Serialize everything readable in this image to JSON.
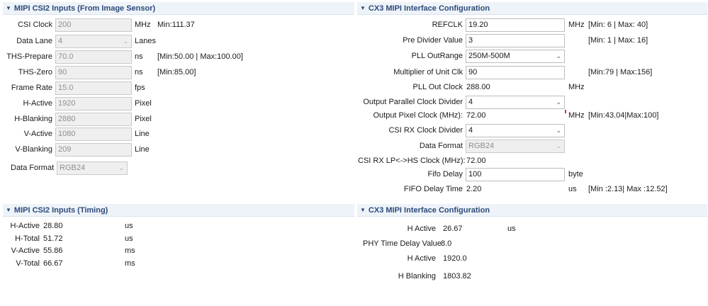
{
  "left_inputs": {
    "title": "MIPI CSI2 Inputs (From Image Sensor)",
    "rows": [
      {
        "label": "CSI Clock",
        "value": "200",
        "unit": "MHz",
        "hint": "Min:111.37"
      },
      {
        "label": "Data Lane",
        "value": "4",
        "unit": "Lanes",
        "hint": ""
      },
      {
        "label": "THS-Prepare",
        "value": "70.0",
        "unit": "ns",
        "hint": "[Min:50.00 | Max:100.00]"
      },
      {
        "label": "THS-Zero",
        "value": "90",
        "unit": "ns",
        "hint": "[Min:85.00]"
      },
      {
        "label": "Frame Rate",
        "value": "15.0",
        "unit": "fps",
        "hint": ""
      },
      {
        "label": "H-Active",
        "value": "1920",
        "unit": "Pixel",
        "hint": ""
      },
      {
        "label": "H-Blanking",
        "value": "2880",
        "unit": "Pixel",
        "hint": ""
      },
      {
        "label": "V-Active",
        "value": "1080",
        "unit": "Line",
        "hint": ""
      },
      {
        "label": "V-Blanking",
        "value": "209",
        "unit": "Line",
        "hint": ""
      },
      {
        "label": "Data Format",
        "value": "RGB24",
        "unit": "",
        "hint": ""
      }
    ]
  },
  "right_config": {
    "title": "CX3 MIPI Interface Configuration",
    "rows": [
      {
        "label": "REFCLK",
        "value": "19.20",
        "unit": "MHz",
        "hint": "[Min: 6 | Max: 40]"
      },
      {
        "label": "Pre Divider Value",
        "value": "3",
        "unit": "",
        "hint": "[Min: 1 | Max: 16]"
      },
      {
        "label": "PLL OutRange",
        "value": "250M-500M",
        "unit": "",
        "hint": ""
      },
      {
        "label": "Multiplier of Unit Clk",
        "value": "90",
        "unit": "",
        "hint": "[Min:79 | Max:156]"
      },
      {
        "label": "PLL Out Clock",
        "value": "288.00",
        "unit": "MHz",
        "hint": ""
      },
      {
        "label": "Output Parallel Clock Divider",
        "value": "4",
        "unit": "",
        "hint": ""
      },
      {
        "label": "Output Pixel Clock (MHz):",
        "value": "72.00",
        "unit": "MHz",
        "hint": "[Min:43.04|Max:100]"
      },
      {
        "label": "CSI RX Clock Divider",
        "value": "4",
        "unit": "",
        "hint": ""
      },
      {
        "label": "Data Format",
        "value": "RGB24",
        "unit": "",
        "hint": ""
      },
      {
        "label": "CSI RX LP<->HS Clock  (MHz):",
        "value": "72.00",
        "unit": "",
        "hint": ""
      },
      {
        "label": "Fifo Delay",
        "value": "100",
        "unit": "byte",
        "hint": ""
      },
      {
        "label": "FIFO Delay Time",
        "value": "2.20",
        "unit": "us",
        "hint": "[Min :2.13| Max :12.52]"
      }
    ]
  },
  "left_timing": {
    "title": "MIPI CSI2 Inputs (Timing)",
    "rows": [
      {
        "label": "H-Active",
        "value": "28.80",
        "unit": "us"
      },
      {
        "label": "H-Total",
        "value": "51.72",
        "unit": "us"
      },
      {
        "label": "V-Active",
        "value": "55.86",
        "unit": "ms"
      },
      {
        "label": "V-Total",
        "value": "66.67",
        "unit": "ms"
      }
    ]
  },
  "right_timing": {
    "title": "CX3 MIPI Interface Configuration",
    "rows": [
      {
        "label": "H Active",
        "value": "26.67",
        "unit": "us"
      },
      {
        "label": "PHY Time Delay Value",
        "value": "8.0",
        "unit": ""
      },
      {
        "label": "H Active",
        "value": "1920.0",
        "unit": ""
      },
      {
        "label": "H Blanking",
        "value": "1803.82",
        "unit": ""
      }
    ]
  },
  "colors": {
    "header_text": "#2c4a7a",
    "header_bg": "#edf3f8",
    "disabled_bg": "#efefef",
    "marker": "#dd3333"
  },
  "icons": {
    "section_toggle": "triangle-down-icon",
    "combo_chevron": "chevron-down-icon"
  }
}
